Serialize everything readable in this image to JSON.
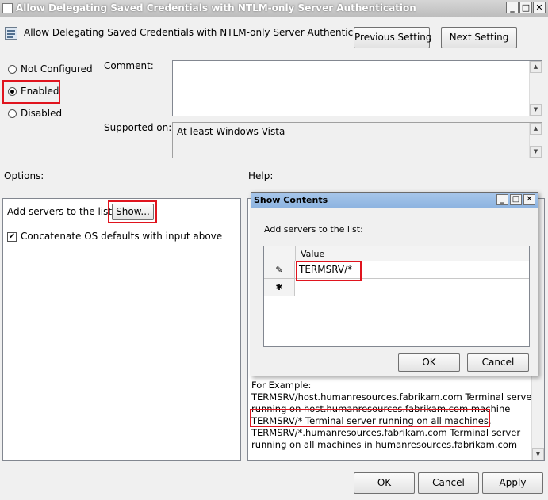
{
  "window": {
    "title": "Allow Delegating Saved Credentials with NTLM-only Server Authentication",
    "minimize": "_",
    "maximize": "□",
    "close": "✕"
  },
  "header": {
    "policy_name": "Allow Delegating Saved Credentials with NTLM-only Server Authentication",
    "previous_setting": "Previous Setting",
    "next_setting": "Next Setting"
  },
  "state": {
    "not_configured": "Not Configured",
    "enabled": "Enabled",
    "disabled": "Disabled",
    "selected": "enabled"
  },
  "comment": {
    "label": "Comment:",
    "value": ""
  },
  "supported": {
    "label": "Supported on:",
    "value": "At least Windows Vista"
  },
  "options": {
    "label": "Options:",
    "add_servers_label": "Add servers to the list:",
    "show_button": "Show...",
    "concatenate_label": "Concatenate OS defaults with input above",
    "concatenate_checked": true
  },
  "help": {
    "label": "Help:",
    "lines": [
      "For Example:",
      "TERMSRV/host.humanresources.fabrikam.com Terminal server",
      "running on host.humanresources.fabrikam.com machine",
      "TERMSRV/* Terminal server running on all machines.",
      "TERMSRV/*.humanresources.fabrikam.com Terminal server",
      "running on all machines in humanresources.fabrikam.com"
    ]
  },
  "show_contents": {
    "title": "Show Contents",
    "prompt": "Add servers to the list:",
    "column_header": "Value",
    "rows": [
      {
        "marker": "✎",
        "value": "TERMSRV/*"
      },
      {
        "marker": "✱",
        "value": ""
      }
    ],
    "ok": "OK",
    "cancel": "Cancel"
  },
  "footer": {
    "ok": "OK",
    "cancel": "Cancel",
    "apply": "Apply"
  },
  "colors": {
    "highlight": "#e0141e",
    "dialog_title": "#8cb3e0"
  }
}
